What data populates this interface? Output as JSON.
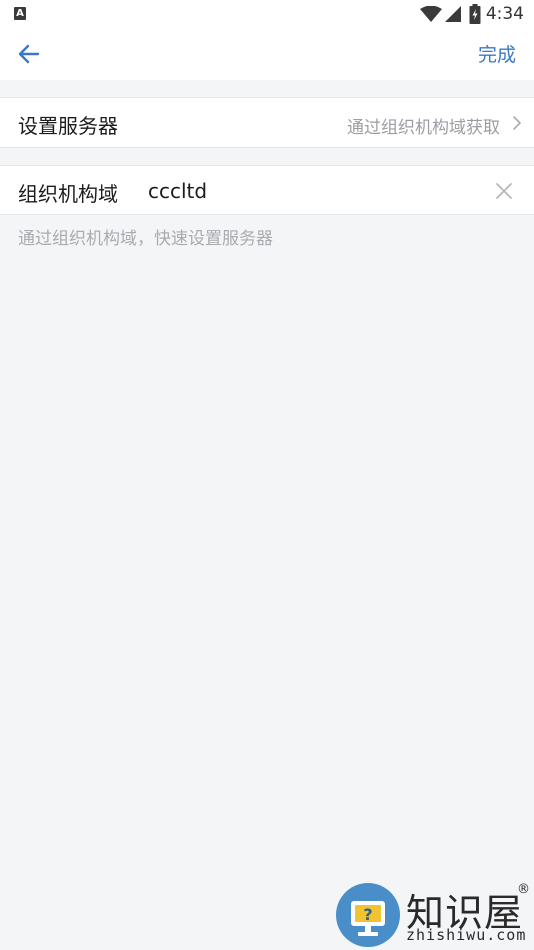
{
  "status_bar": {
    "time": "4:34",
    "left_badge": "A",
    "icons": [
      "wifi-icon",
      "signal-icon",
      "battery-icon"
    ]
  },
  "nav": {
    "done_label": "完成",
    "accent_color": "#3b78c5"
  },
  "server_row": {
    "label": "设置服务器",
    "value": "通过组织机构域获取"
  },
  "domain_row": {
    "label": "组织机构域",
    "value": "cccltd"
  },
  "hint": "通过组织机构域，快速设置服务器",
  "watermark": {
    "cn": "知识屋",
    "reg": "®",
    "en": "zhishiwu.com"
  }
}
